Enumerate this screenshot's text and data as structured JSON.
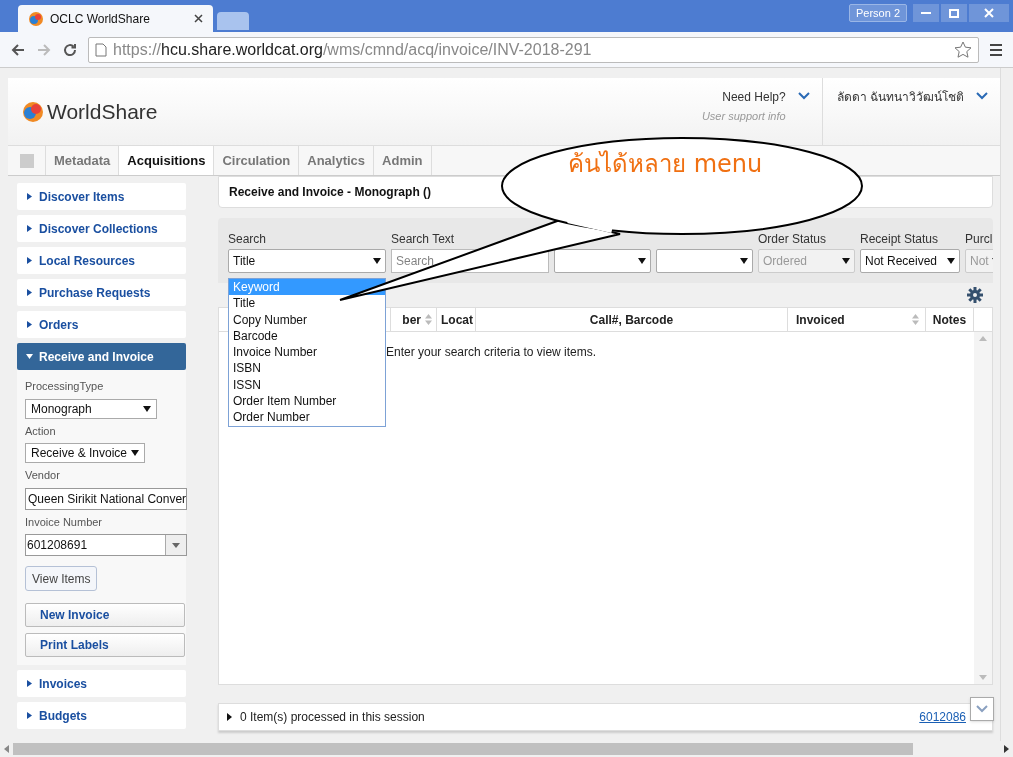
{
  "browser": {
    "tab_title": "OCLC WorldShare",
    "profile": "Person 2",
    "url_scheme": "https://",
    "url_host": "hcu.share.worldcat.org",
    "url_path": "/wms/cmnd/acq/invoice/INV-2018-291"
  },
  "header": {
    "logo": "WorldShare",
    "help": "Need Help?",
    "help_sub": "User support info",
    "user": "ลัดดา ฉันทนาวิวัฒน์โชติ"
  },
  "nav_tabs": [
    {
      "label": "Metadata",
      "selected": false
    },
    {
      "label": "Acquisitions",
      "selected": true
    },
    {
      "label": "Circulation",
      "selected": false
    },
    {
      "label": "Analytics",
      "selected": false
    },
    {
      "label": "Admin",
      "selected": false
    }
  ],
  "sidebar": {
    "items": [
      {
        "label": "Discover Items",
        "expanded": false
      },
      {
        "label": "Discover Collections",
        "expanded": false
      },
      {
        "label": "Local Resources",
        "expanded": false
      },
      {
        "label": "Purchase Requests",
        "expanded": false
      },
      {
        "label": "Orders",
        "expanded": false
      },
      {
        "label": "Receive and Invoice",
        "expanded": true
      },
      {
        "label": "Invoices",
        "expanded": false
      },
      {
        "label": "Budgets",
        "expanded": false
      }
    ],
    "form": {
      "processing_type_label": "ProcessingType",
      "processing_type": "Monograph",
      "action_label": "Action",
      "action": "Receive & Invoice",
      "vendor_label": "Vendor",
      "vendor": "Queen Sirikit National Conver",
      "invoice_label": "Invoice Number",
      "invoice": "601208691",
      "view_button": "View Items",
      "buttons": [
        "New Invoice",
        "Print Labels"
      ]
    }
  },
  "panel_title": "Receive and Invoice - Monograph ()",
  "filters": [
    {
      "kind": "select",
      "label": "Search",
      "value": "Title",
      "disabled": false
    },
    {
      "kind": "text",
      "label": "Search Text",
      "placeholder": "Search"
    },
    {
      "kind": "select",
      "disabled": false
    },
    {
      "kind": "select",
      "disabled": false
    },
    {
      "kind": "select",
      "label": "Order Status",
      "value": "Ordered",
      "disabled": true
    },
    {
      "kind": "select",
      "label": "Receipt Status",
      "value": "Not Received",
      "disabled": false
    },
    {
      "kind": "select",
      "label": "Purcl",
      "value": "Not",
      "disabled": true
    }
  ],
  "search_options": [
    {
      "label": "Keyword",
      "selected": true
    },
    {
      "label": "Title",
      "selected": false
    },
    {
      "label": "Copy Number",
      "selected": false
    },
    {
      "label": "Barcode",
      "selected": false
    },
    {
      "label": "Invoice Number",
      "selected": false
    },
    {
      "label": "ISBN",
      "selected": false
    },
    {
      "label": "ISSN",
      "selected": false
    },
    {
      "label": "Order Item Number",
      "selected": false
    },
    {
      "label": "Order Number",
      "selected": false
    }
  ],
  "table": {
    "columns": [
      {
        "label": "ber",
        "sortable": true
      },
      {
        "label": "Locat",
        "sortable": false
      },
      {
        "label": "Call#, Barcode",
        "sortable": false
      },
      {
        "label": "Invoiced",
        "sortable": true
      },
      {
        "label": "Notes",
        "sortable": false
      }
    ],
    "empty_message": "Enter your search criteria to view items."
  },
  "session": {
    "text": "0 Item(s) processed in this session",
    "link": "6012086"
  },
  "callout": {
    "text": "ค้นได้หลาย menu"
  }
}
